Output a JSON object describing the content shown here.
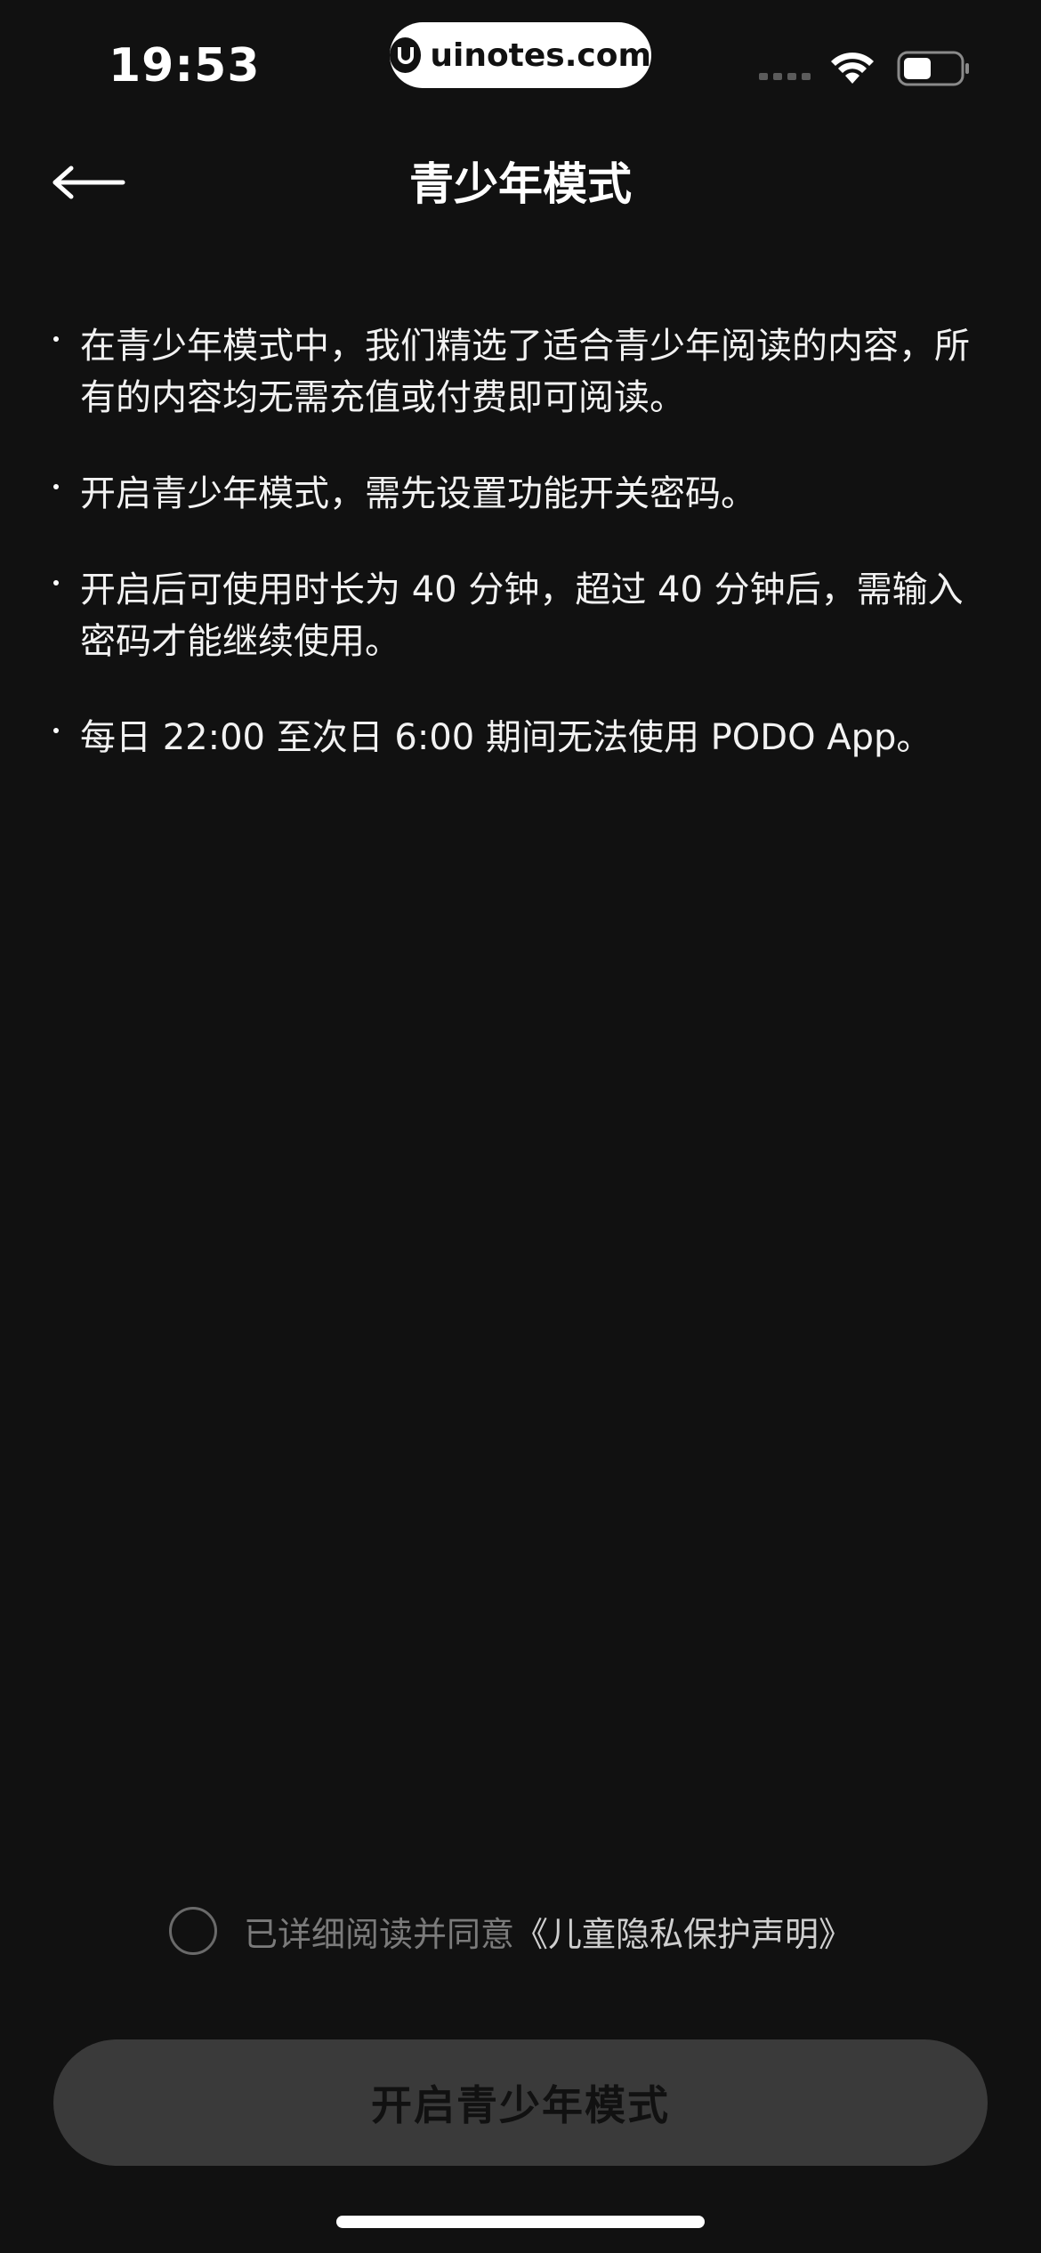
{
  "status_bar": {
    "time": "19:53",
    "watermark": "uinotes.com"
  },
  "header": {
    "title": "青少年模式",
    "back_icon": "arrow-left-icon"
  },
  "content": {
    "bullets": [
      "在青少年模式中，我们精选了适合青少年阅读的内容，所有的内容均无需充值或付费即可阅读。",
      "开启青少年模式，需先设置功能开关密码。",
      "开启后可使用时长为 40 分钟，超过 40 分钟后，需输入密码才能继续使用。",
      "每日 22:00 至次日 6:00 期间无法使用 PODO App。"
    ]
  },
  "agreement": {
    "checked": false,
    "text": "已详细阅读并同意",
    "link": "《儿童隐私保护声明》"
  },
  "primary_button": {
    "label": "开启青少年模式",
    "enabled": false
  },
  "colors": {
    "background": "#111111",
    "text": "#ffffff",
    "muted_text": "#7b7b7b",
    "button_disabled": "#3a3a3a"
  }
}
